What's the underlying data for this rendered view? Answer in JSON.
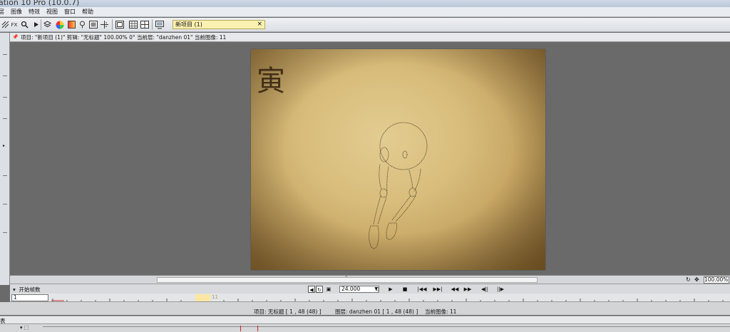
{
  "window": {
    "title": "ation 10 Pro (10.0.7)"
  },
  "menu": [
    "层",
    "图像",
    "特效",
    "视图",
    "窗口",
    "帮助"
  ],
  "toolbar": {
    "fx_label": "FX"
  },
  "document_tab": {
    "label": "新项目 (1)",
    "close": "×"
  },
  "info_bar": {
    "text": "项目: \"新项目 (1)\"   剪辑: \"无标题\"   100.00%   0°   当前层: \"danzhen 01\"   当前图像: 11"
  },
  "canvas": {
    "corner_glyph": "寅"
  },
  "view": {
    "zoom": "100.00%"
  },
  "timeline": {
    "start_frame_label": "开始帧数",
    "fps": "24.000",
    "frame_input": "1",
    "marker_label": "11"
  },
  "status": {
    "project": "项目: 无标题 [ 1 , 48  (48) ]",
    "layer": "图层: danzhen 01 [ 1 , 48  (48) ]",
    "current_image": "当前图像: 11"
  },
  "bottom_panel": {
    "tab_label": "表"
  },
  "colors": {
    "doc_tab": "#fbf1b0",
    "canvas_paper": "#d8bd7c",
    "background": "#6a6a6a"
  }
}
